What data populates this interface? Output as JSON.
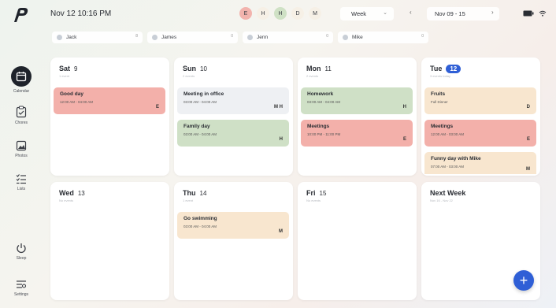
{
  "sidebar": {
    "items": [
      {
        "label": "Calendar",
        "icon": "calendar-icon"
      },
      {
        "label": "Chores",
        "icon": "chores-icon"
      },
      {
        "label": "Photos",
        "icon": "photos-icon"
      },
      {
        "label": "Lists",
        "icon": "lists-icon"
      },
      {
        "label": "Sleep",
        "icon": "power-icon"
      },
      {
        "label": "Settings",
        "icon": "settings-icon"
      }
    ]
  },
  "header": {
    "datetime": "Nov 12 10:16 PM",
    "family": [
      {
        "initial": "E",
        "color": "#f2b3ad"
      },
      {
        "initial": "H",
        "color": "#f6f0e6"
      },
      {
        "initial": "H",
        "color": "#cfe1c5"
      },
      {
        "initial": "D",
        "color": "#f6f0e6"
      },
      {
        "initial": "M",
        "color": "#f6f0e6"
      }
    ],
    "view": "Week",
    "range": "Nov 09 - 15"
  },
  "people": [
    {
      "name": "Jack",
      "count": "8"
    },
    {
      "name": "James",
      "count": "0"
    },
    {
      "name": "Jenn",
      "count": "0"
    },
    {
      "name": "Mike",
      "count": "0"
    }
  ],
  "days": [
    {
      "name": "Sat",
      "num": "9",
      "sub": "1 event",
      "today": false,
      "events": [
        {
          "title": "Good day",
          "time": "12:00 AM - 04:00 AM",
          "who": "E",
          "color": "#f3b0aa"
        }
      ]
    },
    {
      "name": "Sun",
      "num": "10",
      "sub": "2 events",
      "today": false,
      "events": [
        {
          "title": "Meeting in office",
          "time": "03:00 AM - 04:00 AM",
          "who": "M H",
          "color": "#eef0f3"
        },
        {
          "title": "Family day",
          "time": "03:00 AM - 04:00 AM",
          "who": "H",
          "color": "#cfe0c6"
        }
      ]
    },
    {
      "name": "Mon",
      "num": "11",
      "sub": "2 events",
      "today": false,
      "events": [
        {
          "title": "Homework",
          "time": "03:00 AM - 04:00 AM",
          "who": "H",
          "color": "#cfe0c6"
        },
        {
          "title": "Meetings",
          "time": "10:00 PM - 11:00 PM",
          "who": "E",
          "color": "#f3b0aa"
        }
      ]
    },
    {
      "name": "Tue",
      "num": "12",
      "sub": "3 events today",
      "today": true,
      "events": [
        {
          "title": "Fruits",
          "time": "Full Dinner",
          "who": "D",
          "color": "#f8e6cf"
        },
        {
          "title": "Meetings",
          "time": "12:00 AM - 03:00 AM",
          "who": "E",
          "color": "#f3b0aa"
        },
        {
          "title": "Funny day with Mike",
          "time": "07:00 AM - 03:00 AM",
          "who": "M",
          "color": "#f8e6cf"
        }
      ]
    },
    {
      "name": "Wed",
      "num": "13",
      "sub": "No events",
      "today": false,
      "events": []
    },
    {
      "name": "Thu",
      "num": "14",
      "sub": "1 event",
      "today": false,
      "events": [
        {
          "title": "Go swimming",
          "time": "03:00 AM - 04:00 AM",
          "who": "M",
          "color": "#f8e6cf"
        }
      ]
    },
    {
      "name": "Fri",
      "num": "15",
      "sub": "No events",
      "today": false,
      "events": []
    },
    {
      "name": "Next Week",
      "num": "",
      "sub": "Nov 16 - Nov 22",
      "today": false,
      "events": []
    }
  ],
  "fab": {
    "label": "+"
  }
}
